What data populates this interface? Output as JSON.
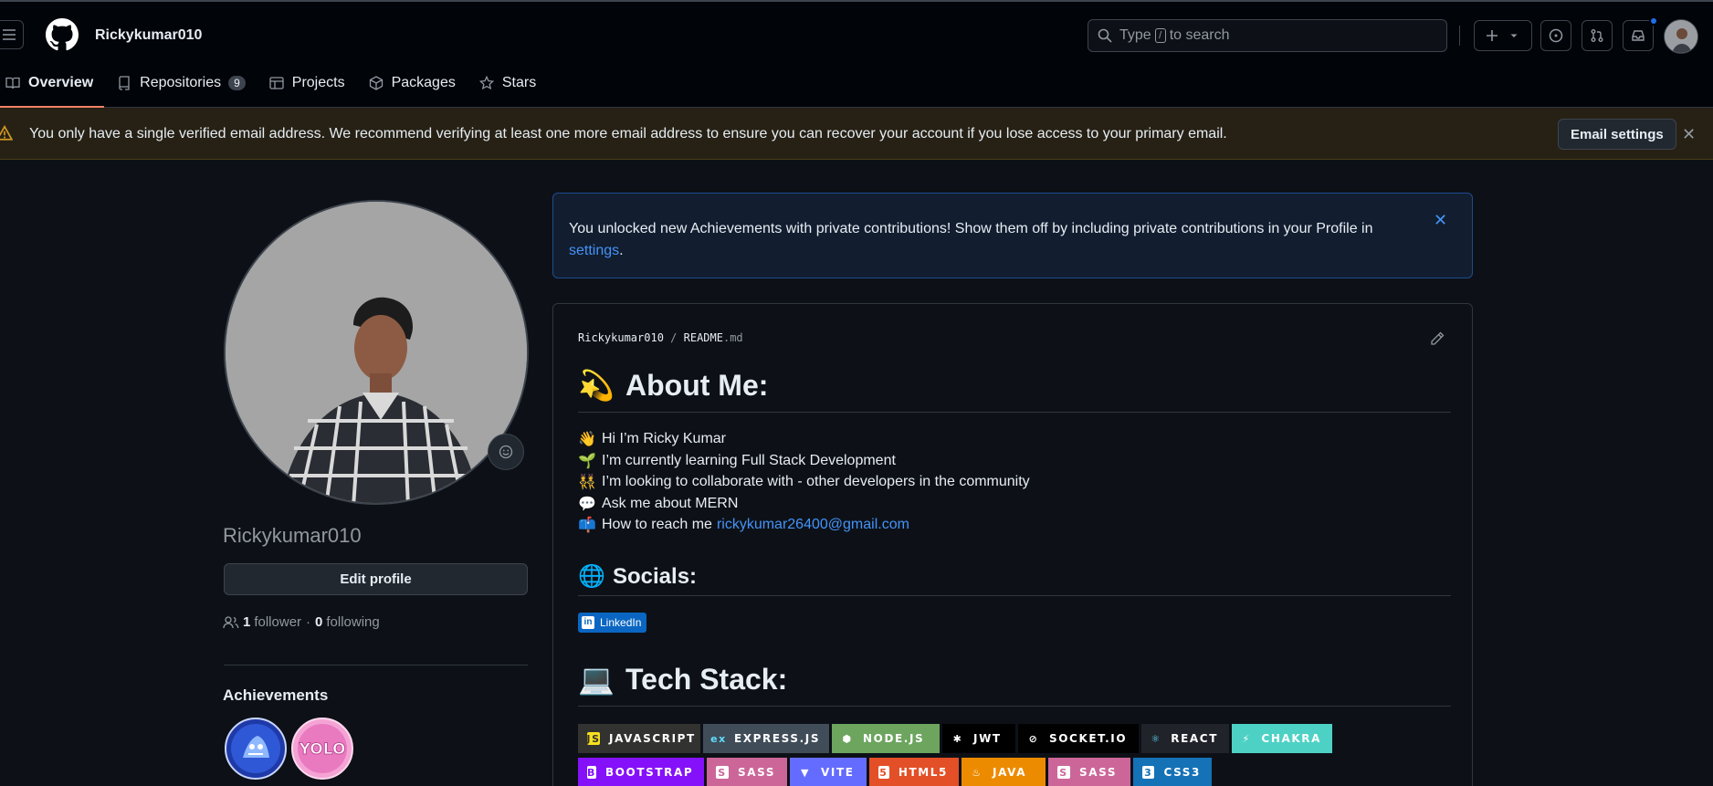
{
  "header": {
    "username": "Rickykumar010",
    "search_before": "Type",
    "search_key": "/",
    "search_after": "to search"
  },
  "tabs": [
    {
      "label": "Overview"
    },
    {
      "label": "Repositories",
      "count": "9"
    },
    {
      "label": "Projects"
    },
    {
      "label": "Packages"
    },
    {
      "label": "Stars"
    }
  ],
  "banner": {
    "text": "You only have a single verified email address. We recommend verifying at least one more email address to ensure you can recover your account if you lose access to your primary email.",
    "button": "Email settings",
    "close": "✕"
  },
  "profile": {
    "login": "Rickykumar010",
    "edit_button": "Edit profile",
    "followers_count": "1",
    "followers_label": "follower",
    "separator": "·",
    "following_count": "0",
    "following_label": "following",
    "achievements_title": "Achievements"
  },
  "flash": {
    "text": "You unlocked new Achievements with private contributions! Show them off by including private contributions in your Profile in",
    "link": "settings",
    "after": ".",
    "close": "✕"
  },
  "readme": {
    "owner": "Rickykumar010",
    "slash": "/",
    "file": "README",
    "ext": ".md",
    "about_title": "About Me:",
    "about_emoji": "💫",
    "lines": [
      {
        "emoji": "👋",
        "text": "Hi I’m Ricky Kumar"
      },
      {
        "emoji": "🌱",
        "text": "I’m currently learning Full Stack Development"
      },
      {
        "emoji": "👯",
        "text": "I’m looking to collaborate with - other developers in the community"
      },
      {
        "emoji": "💬",
        "text": "Ask me about MERN"
      },
      {
        "emoji": "📫",
        "text": "How to reach me",
        "link": "rickykumar26400@gmail.com"
      }
    ],
    "socials_title": "Socials:",
    "socials_emoji": "🌐",
    "linkedin_label": "LinkedIn",
    "tech_title": "Tech Stack:",
    "tech_emoji": "💻"
  },
  "tech_badges_row1": [
    {
      "label": "JAVASCRIPT",
      "bg": "#323330",
      "icon": "JS",
      "icon_bg": "#f7df1e",
      "icon_fg": "#323330"
    },
    {
      "label": "EXPRESS.JS",
      "bg": "#404d59",
      "icon": "ex",
      "icon_bg": "transparent",
      "icon_fg": "#61dafb"
    },
    {
      "label": "NODE.JS",
      "bg": "#6da55f",
      "icon": "⬢",
      "icon_bg": "transparent",
      "icon_fg": "#ffffff"
    },
    {
      "label": "JWT",
      "bg": "#000000",
      "icon": "✱",
      "icon_bg": "transparent",
      "icon_fg": "#ffffff"
    },
    {
      "label": "SOCKET.IO",
      "bg": "#010101",
      "icon": "⊘",
      "icon_bg": "transparent",
      "icon_fg": "#ffffff"
    },
    {
      "label": "REACT",
      "bg": "#20232a",
      "icon": "⚛",
      "icon_bg": "transparent",
      "icon_fg": "#61dafb"
    },
    {
      "label": "CHAKRA",
      "bg": "#4ed1c5",
      "icon": "⚡",
      "icon_bg": "transparent",
      "icon_fg": "#ffffff"
    }
  ],
  "tech_badges_row2": [
    {
      "label": "BOOTSTRAP",
      "bg": "#8511fa",
      "icon": "B",
      "icon_bg": "#ffffff",
      "icon_fg": "#8511fa"
    },
    {
      "label": "SASS",
      "bg": "#cc6699",
      "icon": "S",
      "icon_bg": "#ffffff",
      "icon_fg": "#cc6699"
    },
    {
      "label": "VITE",
      "bg": "#646cff",
      "icon": "▼",
      "icon_bg": "transparent",
      "icon_fg": "#ffffff"
    },
    {
      "label": "HTML5",
      "bg": "#e34f26",
      "icon": "5",
      "icon_bg": "#ffffff",
      "icon_fg": "#e34f26"
    },
    {
      "label": "JAVA",
      "bg": "#ed8b00",
      "icon": "♨",
      "icon_bg": "transparent",
      "icon_fg": "#ffffff"
    },
    {
      "label": "SASS",
      "bg": "#cc6699",
      "icon": "S",
      "icon_bg": "#ffffff",
      "icon_fg": "#cc6699"
    },
    {
      "label": "CSS3",
      "bg": "#1572b6",
      "icon": "3",
      "icon_bg": "#ffffff",
      "icon_fg": "#1572b6"
    }
  ],
  "colors": {
    "accent": "#f78166",
    "link": "#4493f8",
    "bg": "#0d1117",
    "header_bg": "#010409",
    "warning_bg": "#272115"
  }
}
